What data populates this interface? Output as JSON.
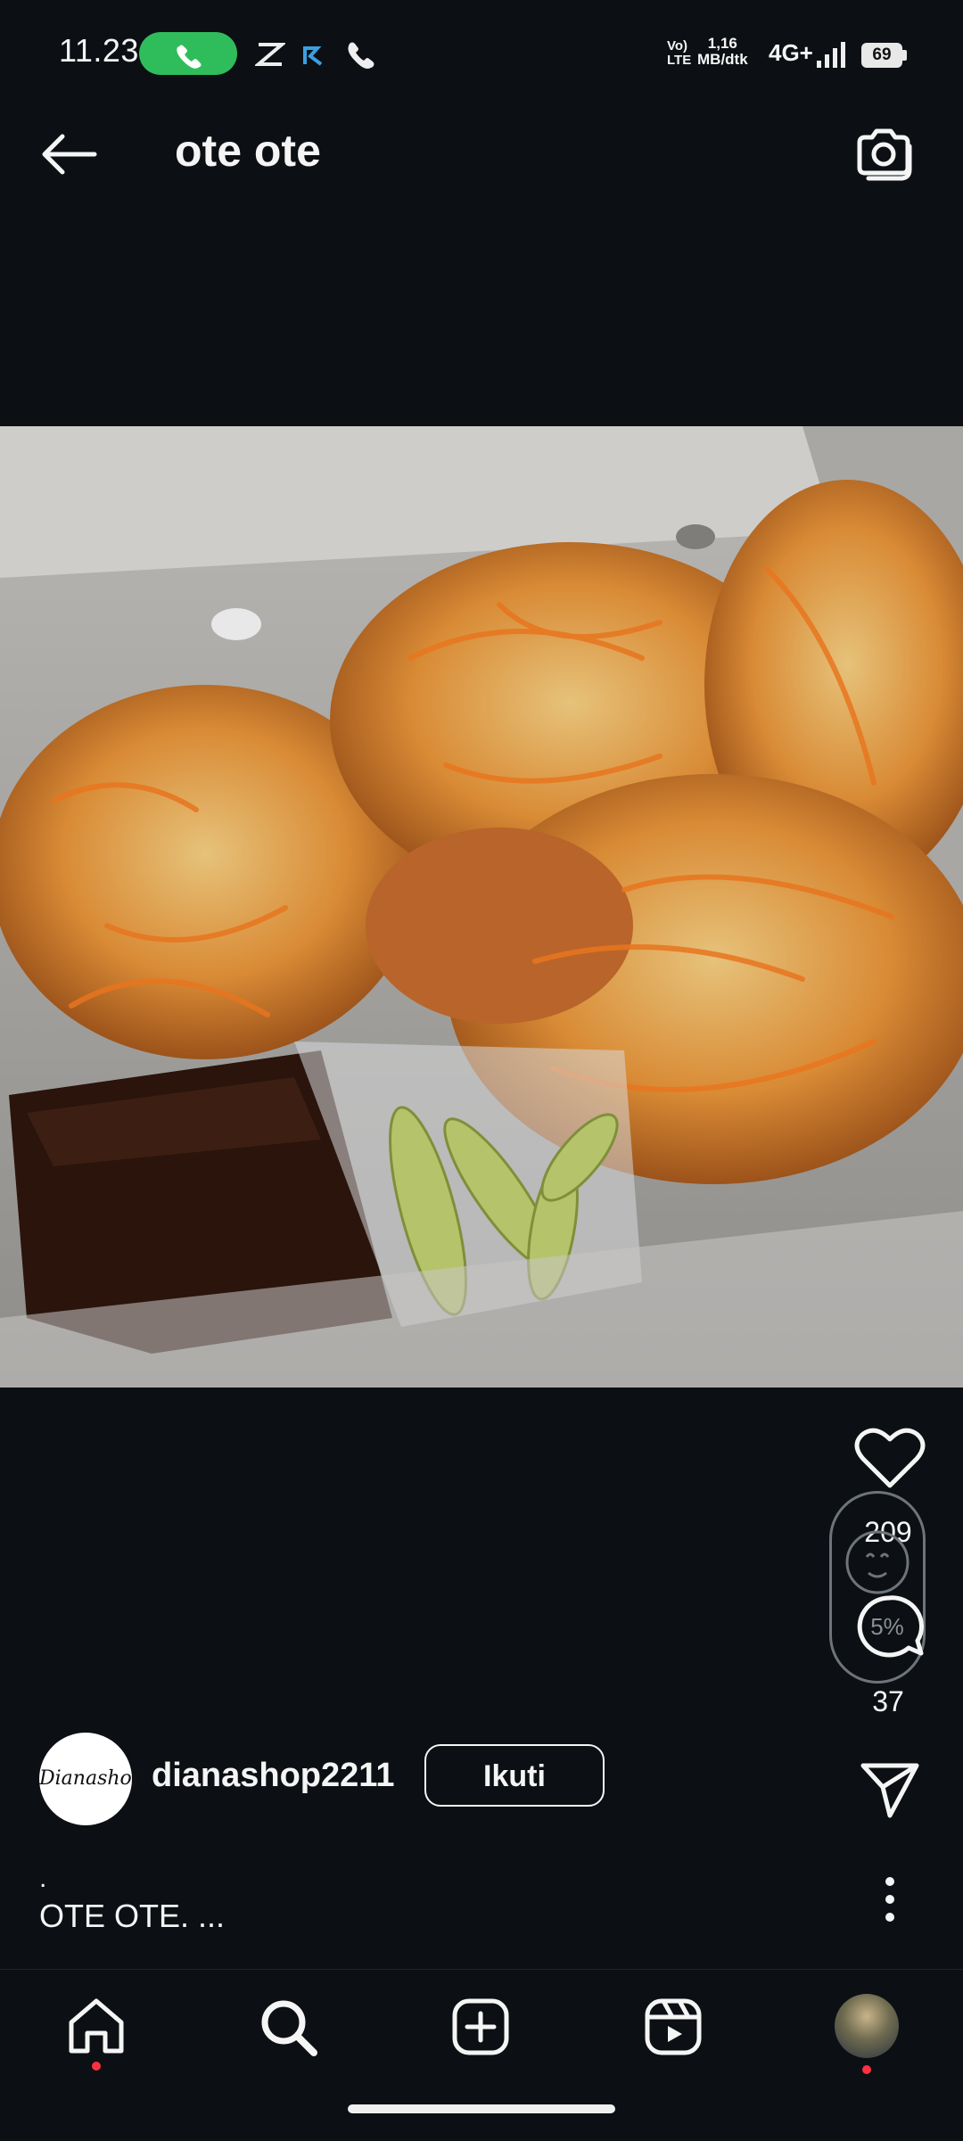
{
  "status_bar": {
    "time": "11.23",
    "volte": "Vo) LTE",
    "net_speed_line1": "1,16",
    "net_speed_line2": "MB/dtk",
    "network_type": "4G+",
    "battery": "69"
  },
  "header": {
    "title": "ote ote",
    "back_icon": "arrow-left-icon",
    "camera_icon": "camera-icon"
  },
  "post": {
    "like_count": "209",
    "comment_count": "37",
    "remix_badge": "5%",
    "username": "dianashop2211",
    "avatar_text": "Dianashop",
    "follow_label": "Ikuti",
    "caption_dot": ".",
    "caption": "OTE OTE. ..."
  },
  "nav": {
    "items": [
      "home-icon",
      "search-icon",
      "create-icon",
      "reels-icon",
      "profile-avatar"
    ]
  },
  "colors": {
    "background": "#0c1014",
    "call_green": "#2fbd5b",
    "notification_red": "#ff3040"
  }
}
